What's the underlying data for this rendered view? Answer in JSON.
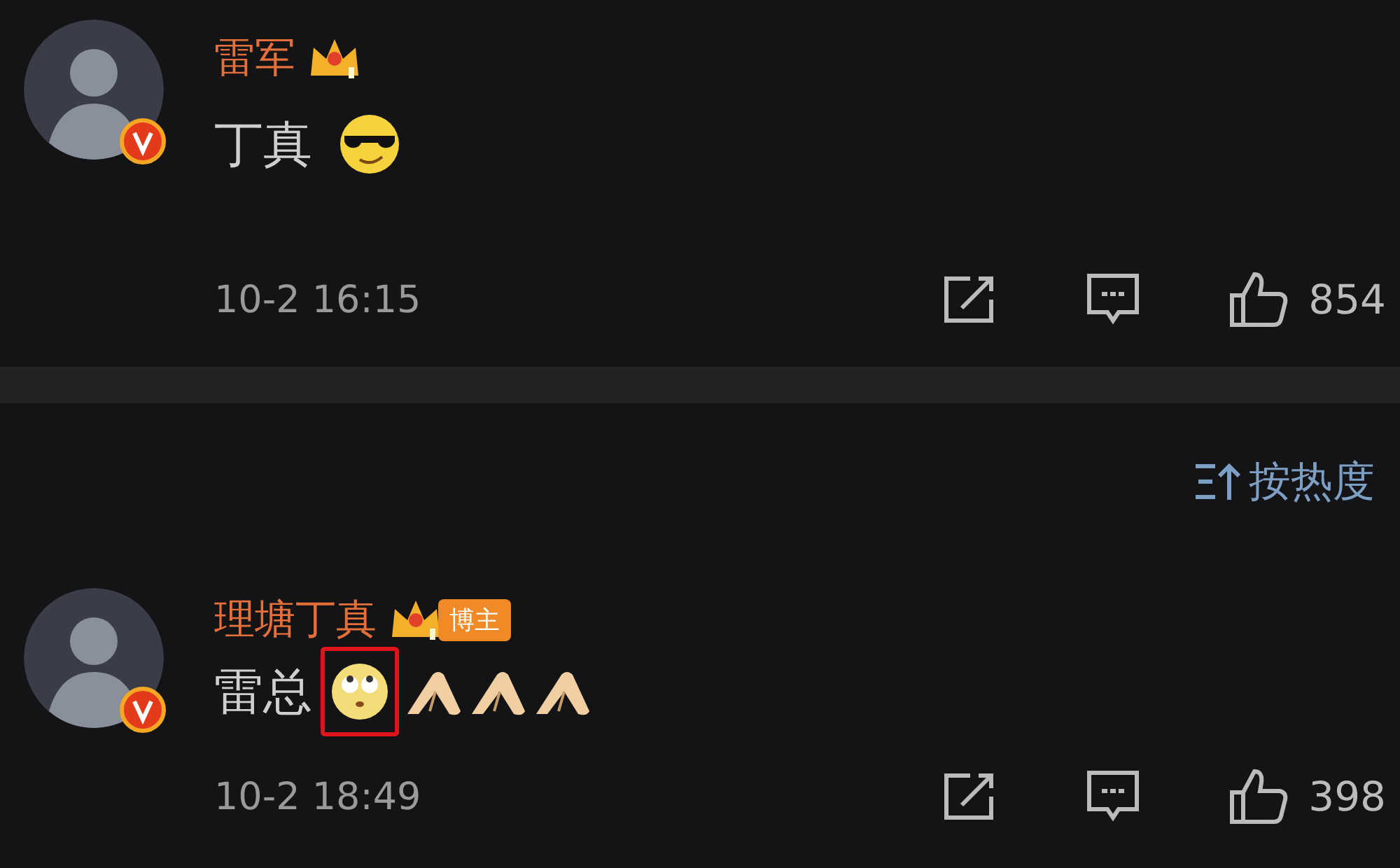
{
  "comments": [
    {
      "name": "雷军",
      "verified": true,
      "content": [
        {
          "kind": "text",
          "text": "丁真"
        },
        {
          "kind": "cool"
        }
      ],
      "time": "10-2 16:15",
      "likes": "854"
    },
    {
      "name": "理塘丁真",
      "badge": "博主",
      "verified": true,
      "content": [
        {
          "kind": "text",
          "text": "雷总"
        },
        {
          "kind": "eyeroll",
          "highlighted": true
        },
        {
          "kind": "hands"
        },
        {
          "kind": "hands"
        },
        {
          "kind": "hands"
        }
      ],
      "time": "10-2 18:49",
      "likes": "398"
    }
  ],
  "sort": {
    "label": "按热度"
  }
}
